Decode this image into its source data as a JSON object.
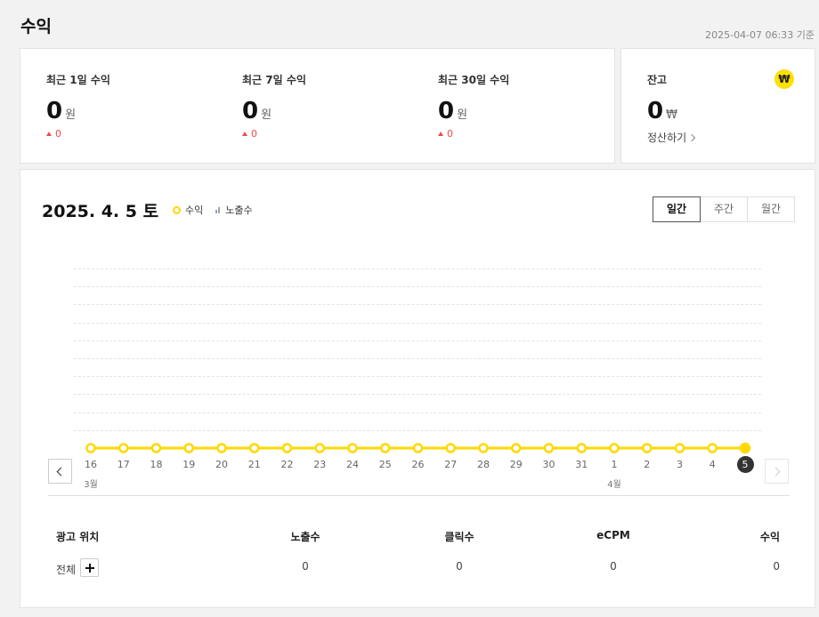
{
  "page": {
    "title": "수익",
    "updated_at": "2025-04-07 06:33 기준"
  },
  "summary": [
    {
      "label": "최근 1일 수익",
      "value": "0",
      "unit": "원",
      "delta": "0"
    },
    {
      "label": "최근 7일 수익",
      "value": "0",
      "unit": "원",
      "delta": "0"
    },
    {
      "label": "최근 30일 수익",
      "value": "0",
      "unit": "원",
      "delta": "0"
    }
  ],
  "balance": {
    "label": "잔고",
    "value": "0",
    "unit": "₩",
    "badge": "₩",
    "link": "정산하기"
  },
  "chart": {
    "date_title": "2025. 4. 5 토",
    "legend": [
      "수익",
      "노출수"
    ],
    "period_tabs": [
      "일간",
      "주간",
      "월간"
    ],
    "active_tab": "일간",
    "month_labels": [
      "3월",
      "4월"
    ],
    "colors": {
      "revenue_line": "#ffd900",
      "active_day": "#333333"
    }
  },
  "chart_data": {
    "type": "line",
    "categories": [
      "16",
      "17",
      "18",
      "19",
      "20",
      "21",
      "22",
      "23",
      "24",
      "25",
      "26",
      "27",
      "28",
      "29",
      "30",
      "31",
      "1",
      "2",
      "3",
      "4",
      "5"
    ],
    "series": [
      {
        "name": "수익",
        "values": [
          0,
          0,
          0,
          0,
          0,
          0,
          0,
          0,
          0,
          0,
          0,
          0,
          0,
          0,
          0,
          0,
          0,
          0,
          0,
          0,
          0
        ]
      }
    ],
    "selected_category": "5",
    "grid": true
  },
  "table": {
    "headers": [
      "광고 위치",
      "노출수",
      "클릭수",
      "eCPM",
      "수익"
    ],
    "rows": [
      [
        "전체",
        "0",
        "0",
        "0",
        "0"
      ]
    ]
  }
}
